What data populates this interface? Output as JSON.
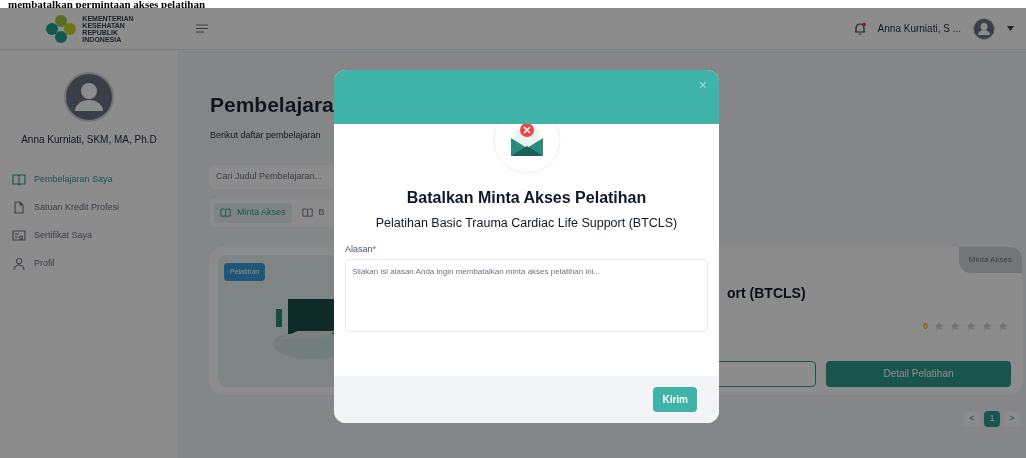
{
  "caption": "membatalkan permintaan akses pelatihan",
  "header": {
    "logo_text": [
      "KEMENTERIAN",
      "KESEHATAN",
      "REPUBLIK",
      "INDONESIA"
    ],
    "user_name": "Anna Kurniati, S ...",
    "notification_dot": true
  },
  "sidebar": {
    "profile_name": "Anna Kurniati, SKM, MA, Ph.D",
    "items": [
      {
        "label": "Pembelajaran Saya",
        "kind": "book",
        "selected": true
      },
      {
        "label": "Satuan Kredit Profesi",
        "kind": "file",
        "selected": false
      },
      {
        "label": "Sertifikat Saya",
        "kind": "certificate",
        "selected": false
      },
      {
        "label": "Profil",
        "kind": "user",
        "selected": false
      }
    ]
  },
  "main": {
    "title": "Pembelajara",
    "subtitle": "Berikut daftar pembelajaran",
    "search": {
      "placeholder": "Cari Judul Pembelajaran..."
    },
    "tabs": [
      {
        "label": "Minta Akses",
        "selected": true
      },
      {
        "label": "B",
        "selected": false
      }
    ],
    "card": {
      "category": "Pelatihan",
      "title": "ort (BTCLS)",
      "status": "Minta Akses",
      "rating": "0",
      "stars": 0,
      "button": "Detail Pelatihan"
    },
    "pagination": {
      "prev": "<",
      "pages": [
        {
          "label": "1",
          "selected": true
        }
      ],
      "next": ">"
    }
  },
  "modal": {
    "title": "Batalkan Minta Akses Pelatihan",
    "subtitle": "Pelatihan Basic Trauma Cardiac Life Support (BTCLS)",
    "close": "×",
    "field": {
      "label": "Alasan",
      "required_mark": "*",
      "placeholder": "Silakan isi alasan Anda ingin membatalkan minta akses pelatihan ini..."
    },
    "submit": "Kirim"
  }
}
